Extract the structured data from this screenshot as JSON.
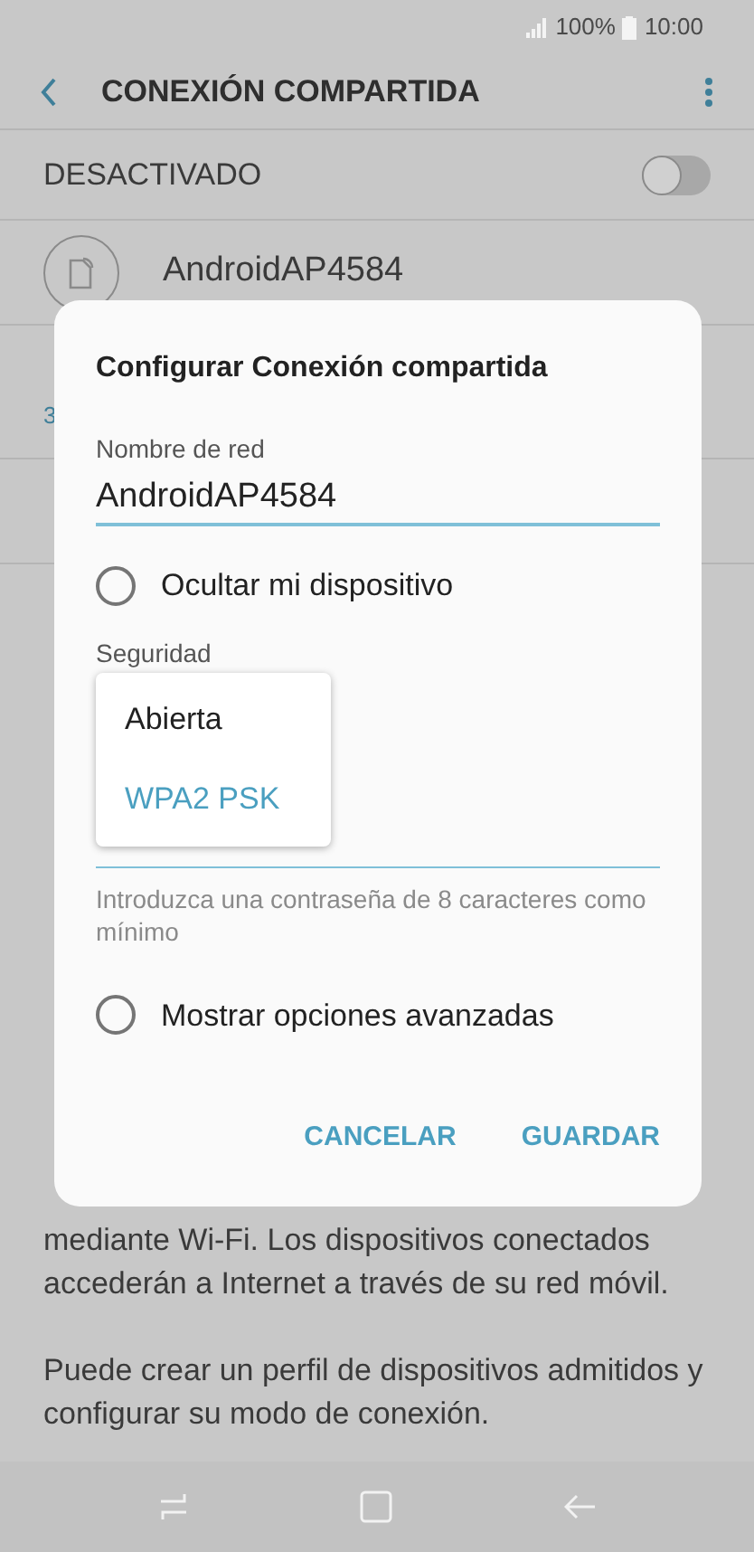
{
  "status_bar": {
    "battery": "100%",
    "time": "10:00"
  },
  "header": {
    "title": "CONEXIÓN COMPARTIDA"
  },
  "master_switch": {
    "label": "DESACTIVADO",
    "on": false
  },
  "network": {
    "name": "AndroidAP4584"
  },
  "hidden_fragments": [
    {
      "text": "3",
      "kind": "link"
    }
  ],
  "paragraphs": [
    {
      "lines": [
        "mediante Wi-Fi. Los dispositivos conectados",
        "accederán a Internet a través de su red móvil."
      ]
    },
    {
      "lines": [
        "Puede crear un perfil de dispositivos admitidos y",
        "configurar su modo de conexión."
      ]
    }
  ],
  "dialog": {
    "title": "Configurar Conexión compartida",
    "name_label": "Nombre de red",
    "name_value": "AndroidAP4584",
    "hide_option": {
      "label": "Ocultar mi dispositivo",
      "checked": false
    },
    "security_label": "Seguridad",
    "security_menu": [
      {
        "label": "Abierta",
        "selected": false
      },
      {
        "label": "WPA2 PSK",
        "selected": true
      }
    ],
    "password_hint": "Introduzca una contraseña de 8 caracteres como mínimo",
    "advanced_option": {
      "label": "Mostrar opciones avanzadas",
      "checked": false
    },
    "buttons": [
      "CANCELAR",
      "GUARDAR"
    ]
  }
}
